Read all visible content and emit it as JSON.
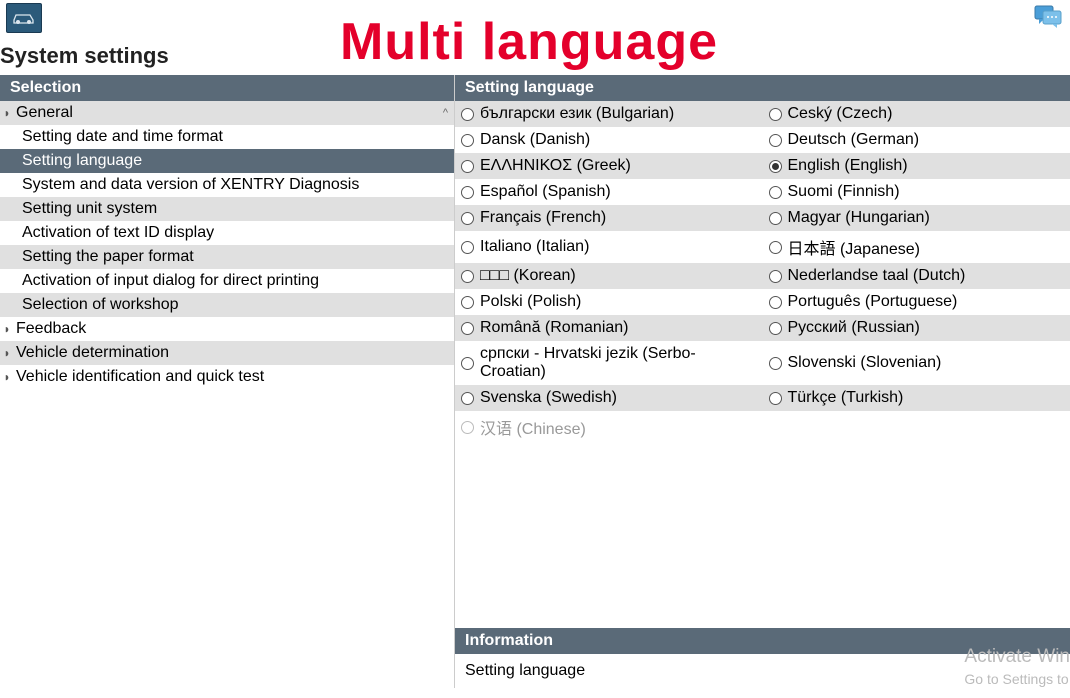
{
  "overlay": "Multi language",
  "page_title": "System settings",
  "left": {
    "header": "Selection",
    "items": [
      {
        "label": "General",
        "level": 0,
        "expandable": true,
        "scroll": true
      },
      {
        "label": "Setting date and time format",
        "level": 1
      },
      {
        "label": "Setting language",
        "level": 1,
        "selected": true
      },
      {
        "label": "System and data version of XENTRY Diagnosis",
        "level": 1
      },
      {
        "label": "Setting unit system",
        "level": 1
      },
      {
        "label": "Activation of text ID display",
        "level": 1
      },
      {
        "label": "Setting the paper format",
        "level": 1
      },
      {
        "label": "Activation of input dialog for direct printing",
        "level": 1
      },
      {
        "label": "Selection of workshop",
        "level": 1
      },
      {
        "label": "Feedback",
        "level": 0,
        "expandable": true
      },
      {
        "label": "Vehicle determination",
        "level": 0,
        "expandable": true
      },
      {
        "label": "Vehicle identification and quick test",
        "level": 0,
        "expandable": true
      }
    ]
  },
  "right": {
    "header": "Setting language",
    "rows": [
      {
        "left": {
          "label": "български език (Bulgarian)"
        },
        "right": {
          "label": "Ceský (Czech)"
        }
      },
      {
        "left": {
          "label": "Dansk (Danish)"
        },
        "right": {
          "label": "Deutsch (German)"
        }
      },
      {
        "left": {
          "label": "ΕΛΛΗΝΙΚΟΣ (Greek)"
        },
        "right": {
          "label": "English (English)",
          "selected": true
        }
      },
      {
        "left": {
          "label": "Español (Spanish)"
        },
        "right": {
          "label": "Suomi (Finnish)"
        }
      },
      {
        "left": {
          "label": "Français (French)"
        },
        "right": {
          "label": "Magyar (Hungarian)"
        }
      },
      {
        "left": {
          "label": "Italiano (Italian)"
        },
        "right": {
          "label": "日本語 (Japanese)"
        }
      },
      {
        "left": {
          "label": "□□□ (Korean)"
        },
        "right": {
          "label": "Nederlandse taal (Dutch)"
        }
      },
      {
        "left": {
          "label": "Polski (Polish)"
        },
        "right": {
          "label": "Português (Portuguese)"
        }
      },
      {
        "left": {
          "label": "Română (Romanian)"
        },
        "right": {
          "label": "Русский (Russian)"
        }
      },
      {
        "left": {
          "label": "српски - Hrvatski jezik (Serbo-Croatian)"
        },
        "right": {
          "label": "Slovenski (Slovenian)"
        }
      },
      {
        "left": {
          "label": "Svenska (Swedish)"
        },
        "right": {
          "label": "Türkçe (Turkish)"
        }
      },
      {
        "left": {
          "label": "汉语 (Chinese)",
          "disabled": true
        },
        "right": null
      }
    ]
  },
  "info": {
    "header": "Information",
    "body": "Setting language"
  },
  "watermark": {
    "line1": "Activate Win",
    "line2": "Go to Settings to"
  }
}
